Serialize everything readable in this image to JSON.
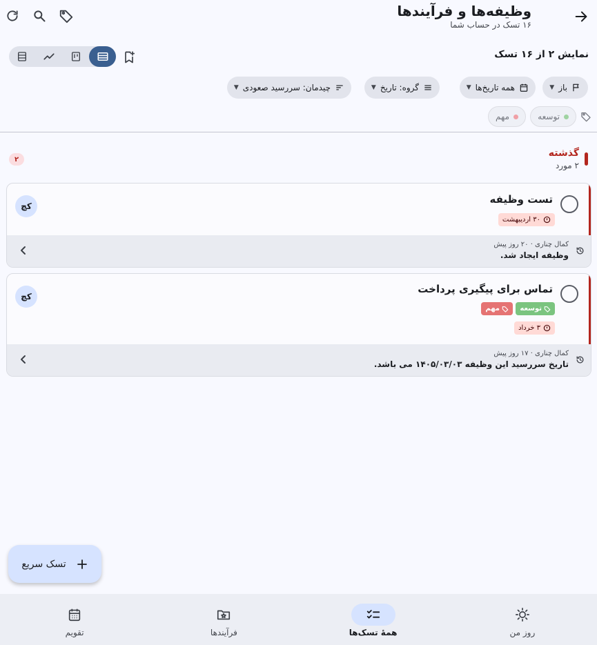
{
  "header": {
    "title": "وظیفه‌ها و فرآیندها",
    "subtitle": "۱۶ تسک در حساب شما"
  },
  "toolbar": {
    "showing_text": "نمایش ۲ از ۱۶ تسک",
    "view_modes": [
      "list",
      "chart",
      "board",
      "table"
    ],
    "active_view": "table"
  },
  "filters": {
    "status": "باز",
    "dates": "همه تاریخ‌ها",
    "group": "گروه: تاریخ",
    "sort": "چیدمان: سررسید صعودی"
  },
  "tags": [
    {
      "label": "توسعه",
      "color": "#7bc47f"
    },
    {
      "label": "مهم",
      "color": "#e57373"
    }
  ],
  "group": {
    "title": "گذشته",
    "count_text": "۲ مورد",
    "badge": "۲"
  },
  "tasks": [
    {
      "title": "تست وظیفه",
      "due": "۳۰ اردیبهشت",
      "tags": [],
      "avatar": "کچ",
      "activity_meta": "کمال چناری · ۲۰ روز پیش",
      "activity_text": "وظیفه ایجاد شد."
    },
    {
      "title": "تماس برای پیگیری پرداخت",
      "due": "۳ خرداد",
      "tags": [
        "توسعه",
        "مهم"
      ],
      "avatar": "کچ",
      "activity_meta": "کمال چناری · ۱۷ روز پیش",
      "activity_text": "تاریخ سررسید این وظیفه ۱۴۰۵/۰۳/۰۳ می باشد."
    }
  ],
  "fab": {
    "label": "تسک سریع"
  },
  "bottom_nav": [
    {
      "label": "روز من",
      "icon": "sun-icon"
    },
    {
      "label": "همهٔ تسک‌ها",
      "icon": "checklist-icon",
      "active": true
    },
    {
      "label": "فرآیندها",
      "icon": "folder-star-icon"
    },
    {
      "label": "تقویم",
      "icon": "calendar-icon"
    }
  ],
  "colors": {
    "accent": "#3a5f90",
    "overdue": "#b3261e",
    "tag_green": "#7bc47f",
    "tag_red": "#e57373"
  }
}
